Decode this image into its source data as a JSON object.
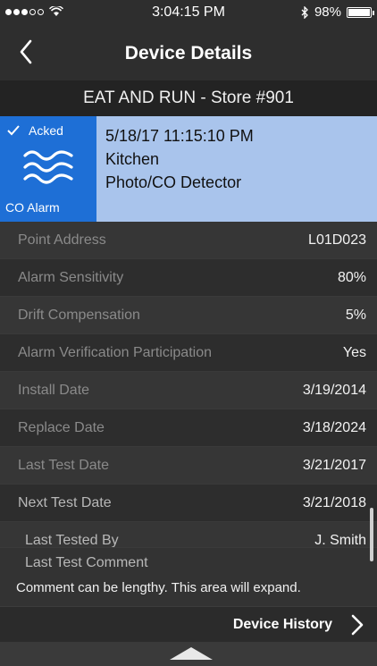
{
  "status_bar": {
    "time": "3:04:15 PM",
    "battery": "98%",
    "battery_level": 0.98,
    "wifi_icon": "wifi-icon",
    "bluetooth_icon": "bluetooth-icon"
  },
  "nav": {
    "title": "Device Details",
    "back_icon": "chevron-left-icon"
  },
  "store": {
    "name": "EAT AND RUN - Store #901"
  },
  "alarm": {
    "ack_label": "Acked",
    "type_label": "CO Alarm",
    "timestamp": "5/18/17  11:15:10 PM",
    "location": "Kitchen",
    "device": "Photo/CO Detector",
    "colors": {
      "badge": "#1e6fd6",
      "card": "#a9c4ec"
    }
  },
  "details": [
    {
      "label": "Point Address",
      "value": "L01D023"
    },
    {
      "label": "Alarm Sensitivity",
      "value": "80%"
    },
    {
      "label": "Drift Compensation",
      "value": "5%"
    },
    {
      "label": "Alarm Verification Participation",
      "value": "Yes"
    },
    {
      "label": "Install Date",
      "value": "3/19/2014"
    },
    {
      "label": "Replace Date",
      "value": "3/18/2024"
    },
    {
      "label": "Last Test Date",
      "value": "3/21/2017"
    },
    {
      "label": "Next Test Date",
      "value": "3/21/2018"
    },
    {
      "label": "Last Tested By",
      "value": "J. Smith"
    }
  ],
  "comment": {
    "label": "Last Test Comment",
    "text": "Comment can be lengthy. This area will expand."
  },
  "history": {
    "label": "Device History"
  }
}
